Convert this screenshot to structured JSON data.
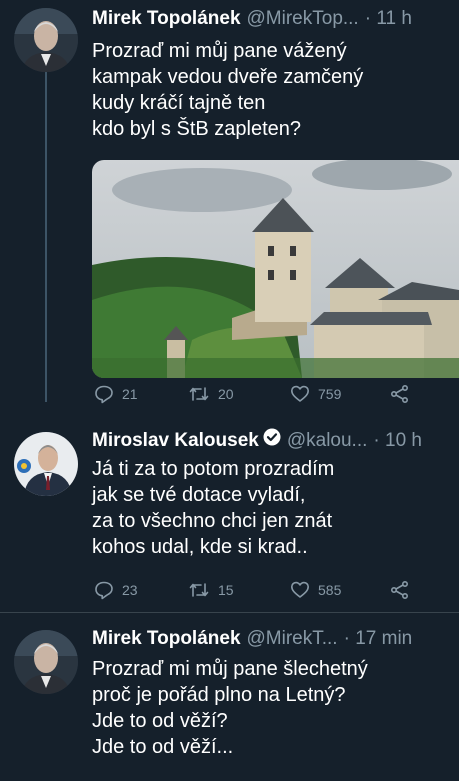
{
  "tweets": [
    {
      "name": "Mirek Topolánek",
      "handle": "@MirekTop...",
      "time": "· 11 h",
      "text": "Prozraď mi můj pane vážený\nkampak vedou dveře zamčený\nkudy kráčí tajně ten\nkdo byl s ŠtB zapleten?",
      "replies": "21",
      "retweets": "20",
      "likes": "759"
    },
    {
      "name": "Miroslav Kalousek",
      "handle": "@kalou...",
      "time": "· 10 h",
      "verified": true,
      "text": "Já ti za to potom prozradím\njak se tvé dotace vyladí,\nza to všechno chci jen znát\nkohos udal, kde si krad..",
      "replies": "23",
      "retweets": "15",
      "likes": "585"
    },
    {
      "name": "Mirek Topolánek",
      "handle": "@MirekT...",
      "time": "· 17 min",
      "text": "Prozraď mi můj pane šlechetný\nproč je pořád plno na Letný?\nJde to od věží?\nJde to od věží..."
    }
  ],
  "colors": {
    "background": "#15202b",
    "text": "#ffffff",
    "secondary": "#8899a6",
    "verified": "#1da1f2"
  },
  "icons": {
    "reply": "reply-icon",
    "retweet": "retweet-icon",
    "like": "heart-icon",
    "share": "share-icon"
  }
}
